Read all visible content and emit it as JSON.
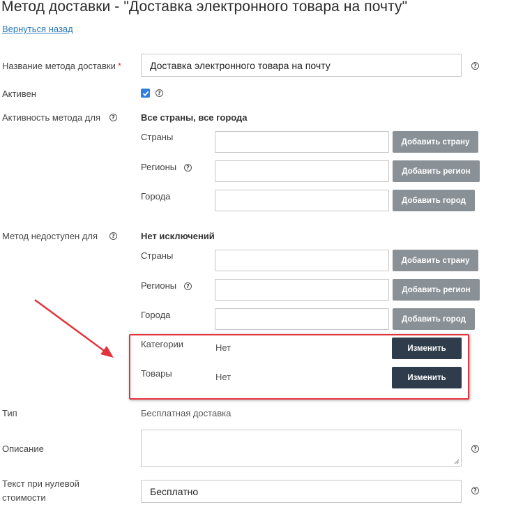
{
  "page": {
    "title": "Метод доставки - \"Доставка электронного товара на почту\"",
    "back_link": "Вернуться назад"
  },
  "name_field": {
    "label": "Название метода доставки",
    "required_mark": "*",
    "value": "Доставка электронного товара на почту"
  },
  "active": {
    "label": "Активен",
    "checked": true
  },
  "activity": {
    "label": "Активность метода для",
    "summary": "Все страны, все города",
    "countries_label": "Страны",
    "countries_button": "Добавить страну",
    "regions_label": "Регионы",
    "regions_button": "Добавить регион",
    "cities_label": "Города",
    "cities_button": "Добавить город"
  },
  "unavailable": {
    "label": "Метод недоступен для",
    "summary": "Нет исключений",
    "countries_label": "Страны",
    "countries_button": "Добавить страну",
    "regions_label": "Регионы",
    "regions_button": "Добавить регион",
    "cities_label": "Города",
    "cities_button": "Добавить город",
    "categories_label": "Категории",
    "categories_value": "Нет",
    "categories_button": "Изменить",
    "products_label": "Товары",
    "products_value": "Нет",
    "products_button": "Изменить"
  },
  "type": {
    "label": "Тип",
    "value": "Бесплатная доставка"
  },
  "description": {
    "label": "Описание",
    "value": ""
  },
  "zero_cost_text": {
    "label_line1": "Текст при нулевой",
    "label_line2": "стоимости",
    "value": "Бесплатно"
  },
  "colors": {
    "accent": "#2f7fe0",
    "gray_button": "#8a9196",
    "dark_button": "#2e3c4c",
    "highlight": "#e3343c",
    "link": "#2a7abf"
  }
}
